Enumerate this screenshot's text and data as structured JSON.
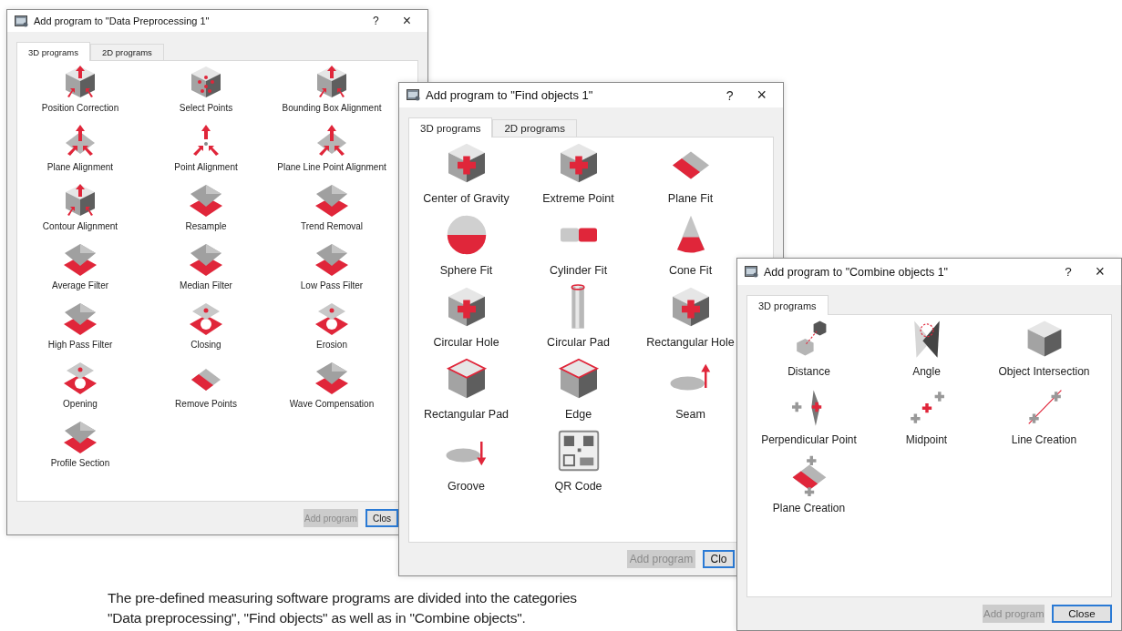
{
  "windows": [
    {
      "title": "Add program to \"Data Preprocessing 1\"",
      "help": "?",
      "close": "×",
      "tabs": [
        {
          "label": "3D programs",
          "selected": true
        },
        {
          "label": "2D programs",
          "selected": false
        }
      ],
      "programs": [
        "Position Correction",
        "Select Points",
        "Bounding Box Alignment",
        "Plane Alignment",
        "Point Alignment",
        "Plane Line Point Alignment",
        "Contour Alignment",
        "Resample",
        "Trend Removal",
        "Average Filter",
        "Median Filter",
        "Low Pass Filter",
        "High Pass Filter",
        "Closing",
        "Erosion",
        "Opening",
        "Remove Points",
        "Wave Compensation",
        "Profile Section"
      ],
      "buttons": [
        {
          "label": "Add program",
          "disabled": true
        },
        {
          "label": "Clos",
          "disabled": false
        }
      ]
    },
    {
      "title": "Add program to \"Find objects 1\"",
      "help": "?",
      "close": "×",
      "tabs": [
        {
          "label": "3D programs",
          "selected": true
        },
        {
          "label": "2D programs",
          "selected": false
        }
      ],
      "programs": [
        "Center of Gravity",
        "Extreme Point",
        "Plane Fit",
        "Sphere Fit",
        "Cylinder Fit",
        "Cone Fit",
        "Circular Hole",
        "Circular Pad",
        "Rectangular Hole",
        "Rectangular Pad",
        "Edge",
        "Seam",
        "Groove",
        "QR Code"
      ],
      "buttons": [
        {
          "label": "Add program",
          "disabled": true
        },
        {
          "label": "Clo",
          "disabled": false
        }
      ]
    },
    {
      "title": "Add program to \"Combine objects 1\"",
      "help": "?",
      "close": "×",
      "tabs": [
        {
          "label": "3D programs",
          "selected": true
        }
      ],
      "programs": [
        "Distance",
        "Angle",
        "Object Intersection",
        "Perpendicular Point",
        "Midpoint",
        "Line Creation",
        "Plane Creation"
      ],
      "buttons": [
        {
          "label": "Add program",
          "disabled": true
        },
        {
          "label": "Close",
          "disabled": false
        }
      ]
    }
  ],
  "caption": "The pre-defined measuring software programs are divided into the categories \"Data preprocessing\", \"Find objects\" as well as in \"Combine objects\"."
}
